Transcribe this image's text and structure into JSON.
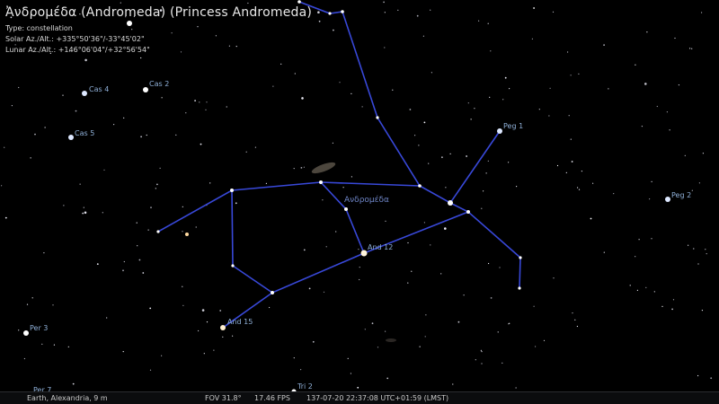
{
  "object_info": {
    "title": "Ἀνδρομέδα (Andromeda) (Princess Andromeda)",
    "type": "Type: constellation",
    "solar_azalt": "Solar Az./Alt.: +335°50'36\"/-33°45'02\"",
    "lunar_azalt": "Lunar Az./Alt.: +146°06'04\"/+32°56'54\""
  },
  "sky_labels": {
    "constellation": "Ανδρομέδα",
    "cas4": "Cas 4",
    "cas2": "Cas 2",
    "cas5": "Cas 5",
    "peg1": "Peg 1",
    "peg2": "Peg 2",
    "and12": "And 12",
    "and15": "And 15",
    "per3": "Per 3",
    "per7": "Per 7",
    "tri2": "Tri 2"
  },
  "status_bar": {
    "location": "Earth, Alexandria, 9 m",
    "fov": "FOV 31.8°",
    "fps": "17.46 FPS",
    "datetime": "137-07-20 22:37:08 UTC+01:59 (LMST)"
  },
  "colors": {
    "background": "#000000",
    "constellation_lines": "#3848d8",
    "label_star": "#8fb0d8",
    "label_constellation": "#6f86c8"
  }
}
